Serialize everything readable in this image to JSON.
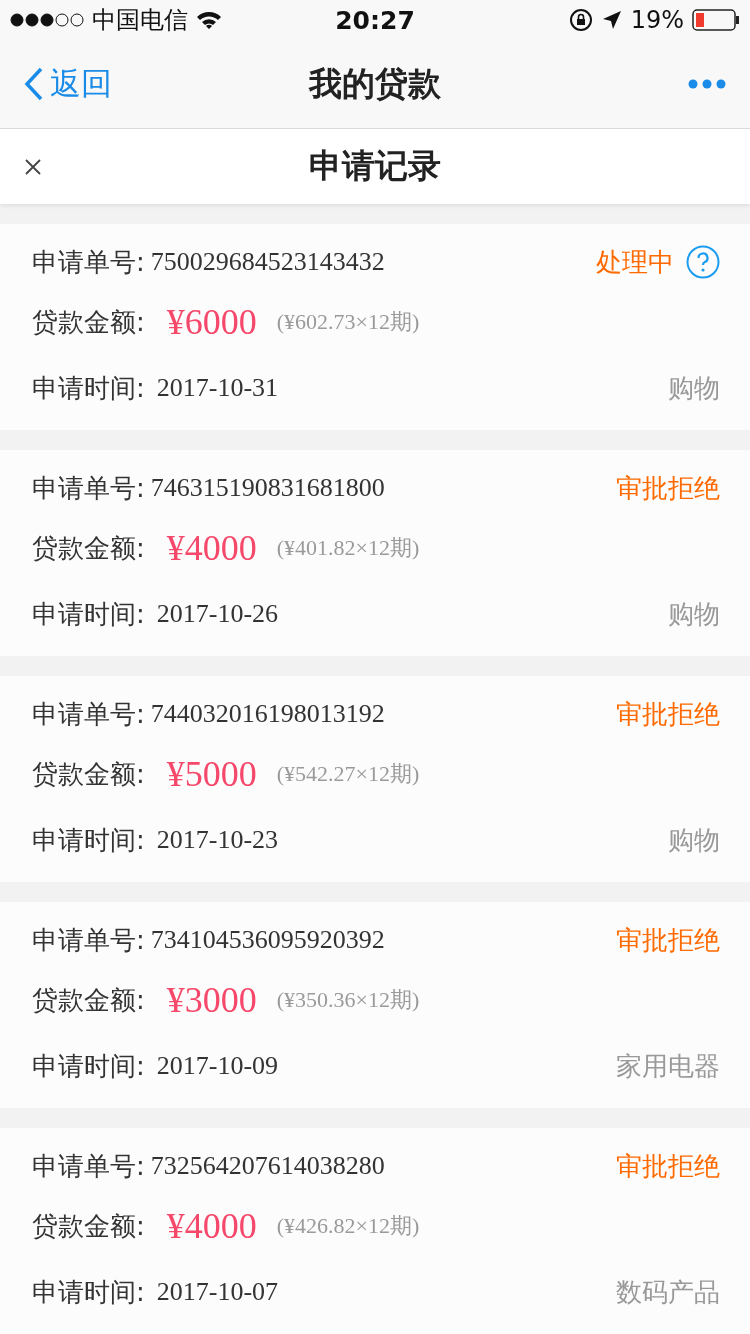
{
  "status_bar": {
    "carrier": "中国电信",
    "time": "20:27",
    "battery": "19%"
  },
  "nav": {
    "back": "返回",
    "title": "我的贷款"
  },
  "sheet": {
    "title": "申请记录"
  },
  "records": [
    {
      "id_label": "申请单号:",
      "id": "750029684523143432",
      "status": "处理中",
      "help": true,
      "amount_label": "贷款金额:",
      "amount": "¥6000",
      "installment": "(¥602.73×12期)",
      "time_label": "申请时间:",
      "date": "2017-10-31",
      "category": "购物"
    },
    {
      "id_label": "申请单号:",
      "id": "746315190831681800",
      "status": "审批拒绝",
      "help": false,
      "amount_label": "贷款金额:",
      "amount": "¥4000",
      "installment": "(¥401.82×12期)",
      "time_label": "申请时间:",
      "date": "2017-10-26",
      "category": "购物"
    },
    {
      "id_label": "申请单号:",
      "id": "744032016198013192",
      "status": "审批拒绝",
      "help": false,
      "amount_label": "贷款金额:",
      "amount": "¥5000",
      "installment": "(¥542.27×12期)",
      "time_label": "申请时间:",
      "date": "2017-10-23",
      "category": "购物"
    },
    {
      "id_label": "申请单号:",
      "id": "734104536095920392",
      "status": "审批拒绝",
      "help": false,
      "amount_label": "贷款金额:",
      "amount": "¥3000",
      "installment": "(¥350.36×12期)",
      "time_label": "申请时间:",
      "date": "2017-10-09",
      "category": "家用电器"
    },
    {
      "id_label": "申请单号:",
      "id": "732564207614038280",
      "status": "审批拒绝",
      "help": false,
      "amount_label": "贷款金额:",
      "amount": "¥4000",
      "installment": "(¥426.82×12期)",
      "time_label": "申请时间:",
      "date": "2017-10-07",
      "category": "数码产品"
    }
  ]
}
